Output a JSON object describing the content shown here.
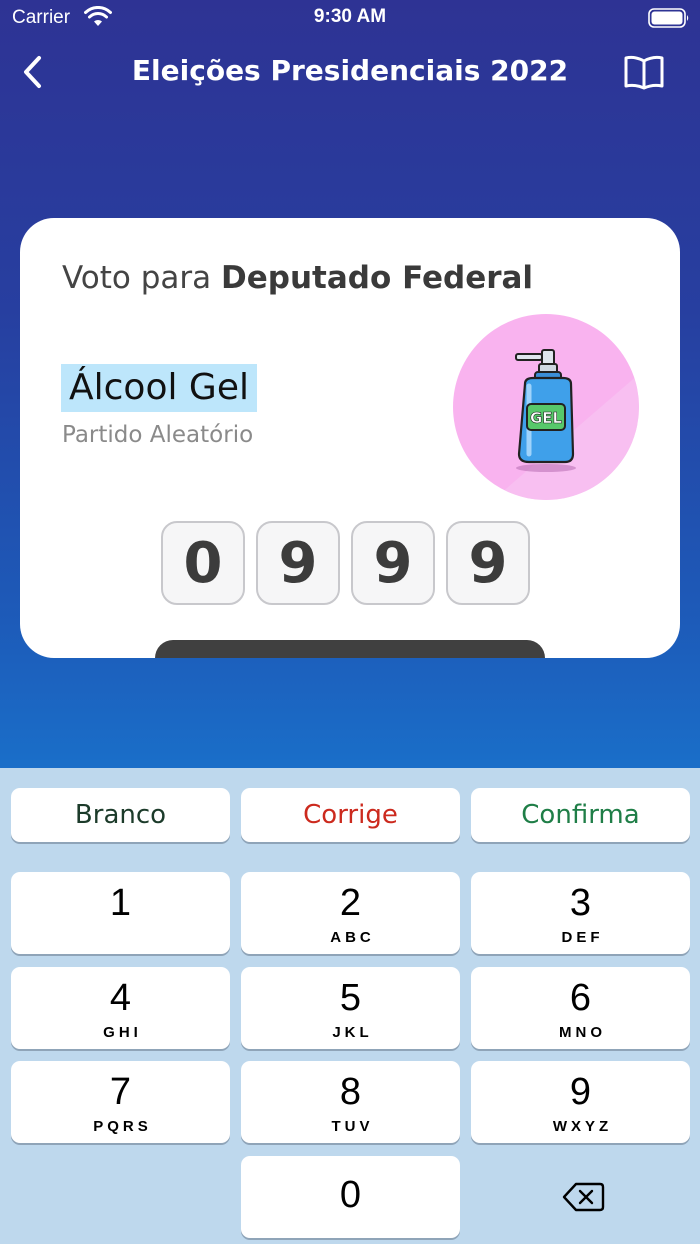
{
  "status_bar": {
    "carrier": "Carrier",
    "time": "9:30 AM"
  },
  "nav": {
    "title": "Eleições Presidenciais 2022",
    "back_icon": "chevron-left-icon",
    "book_icon": "book-icon"
  },
  "card": {
    "heading_prefix": "Voto para",
    "heading_office": "Deputado Federal",
    "candidate_name": "Álcool Gel",
    "party": "Partido Aleatório",
    "photo_label": "GEL",
    "digits": [
      "0",
      "9",
      "9",
      "9"
    ]
  },
  "keypad": {
    "actions": {
      "blank": "Branco",
      "correct": "Corrige",
      "confirm": "Confirma"
    },
    "keys": [
      {
        "digit": "1",
        "letters": ""
      },
      {
        "digit": "2",
        "letters": "ABC"
      },
      {
        "digit": "3",
        "letters": "DEF"
      },
      {
        "digit": "4",
        "letters": "GHI"
      },
      {
        "digit": "5",
        "letters": "JKL"
      },
      {
        "digit": "6",
        "letters": "MNO"
      },
      {
        "digit": "7",
        "letters": "PQRS"
      },
      {
        "digit": "8",
        "letters": "TUV"
      },
      {
        "digit": "9",
        "letters": "WXYZ"
      },
      {
        "digit": "0",
        "letters": ""
      }
    ]
  },
  "colors": {
    "blank": "#1c3b2a",
    "correct": "#cc2a1e",
    "confirm": "#1f7e47",
    "highlight": "#bde6fb",
    "photo_bg": "#f9b3ef"
  }
}
